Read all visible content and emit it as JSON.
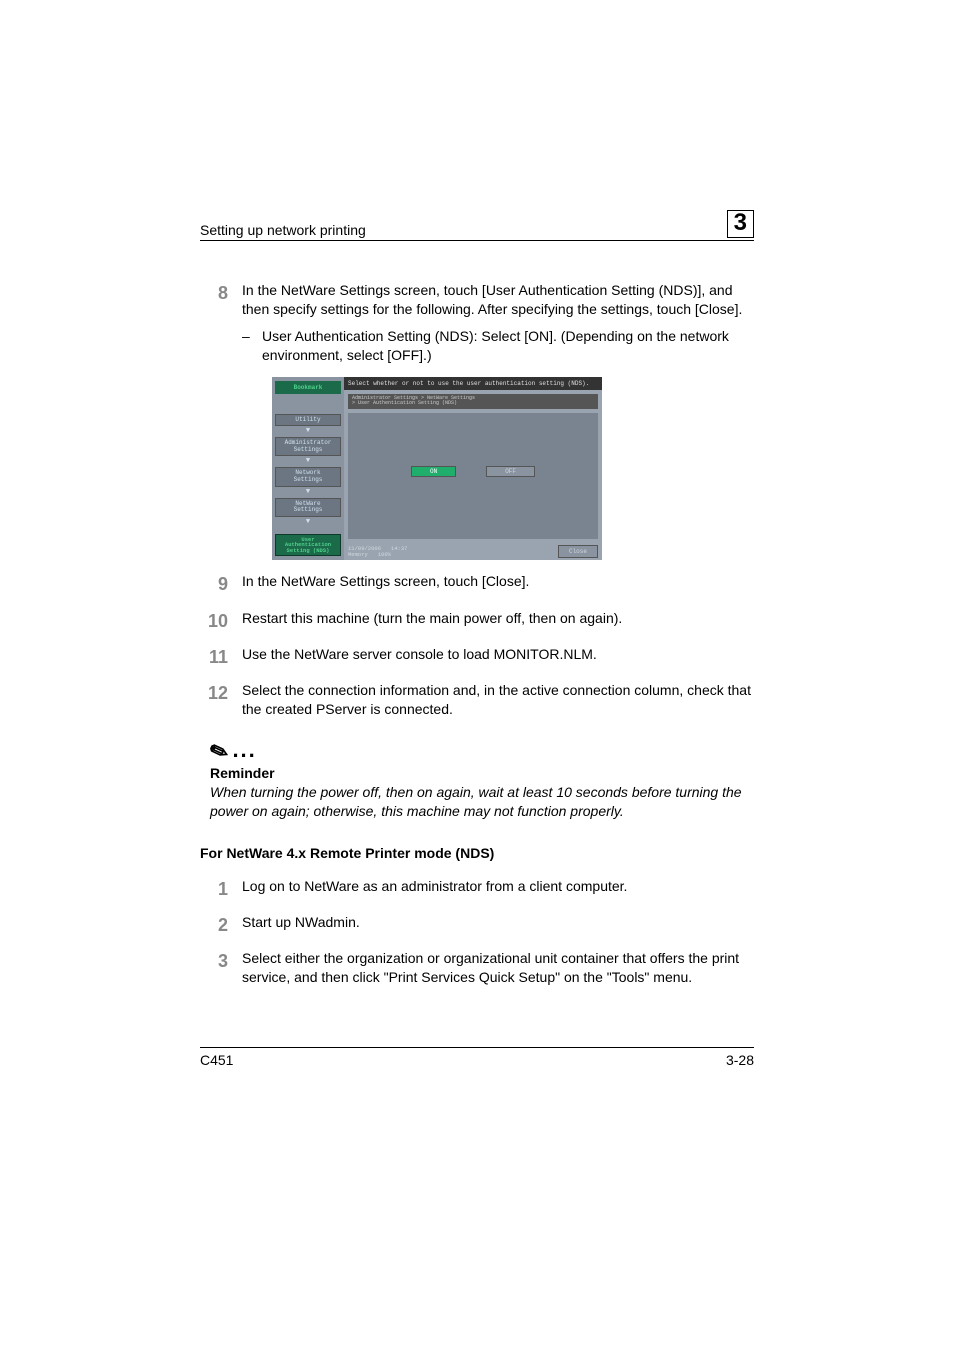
{
  "header": {
    "title": "Setting up network printing",
    "chapter": "3"
  },
  "steps_a": [
    {
      "num": "8",
      "text": "In the NetWare Settings screen, touch [User Authentication Setting (NDS)], and then specify settings for the following. After specifying the settings, touch [Close]."
    },
    {
      "num": "9",
      "text": "In the NetWare Settings screen, touch [Close]."
    },
    {
      "num": "10",
      "text": "Restart this machine (turn the main power off, then on again)."
    },
    {
      "num": "11",
      "text": "Use the NetWare server console to load MONITOR.NLM."
    },
    {
      "num": "12",
      "text": "Select the connection information and, in the active connection column, check that the created PServer is connected."
    }
  ],
  "sub8": "User Authentication Setting (NDS): Select [ON]. (Depending on the network environment, select [OFF].)",
  "dash": "–",
  "screen": {
    "bookmark": "Bookmark",
    "nav": {
      "utility": "Utility",
      "admin": "Administrator\nSettings",
      "network": "Network\nSettings",
      "netware": "NetWare\nSettings",
      "active": "User\nAuthentication\nSetting (NDS)"
    },
    "instruction": "Select whether or not to use the user authentication setting (NDS).",
    "breadcrumb": "Administrator Settings > NetWare Settings\n> User Authentication Setting (NDS)",
    "on": "ON",
    "off": "OFF",
    "date": "11/09/2006",
    "time": "14:37",
    "memory_label": "Memory",
    "memory_value": "100%",
    "close": "Close"
  },
  "note": {
    "label": "Reminder",
    "body": "When turning the power off, then on again, wait at least 10 seconds before turning the power on again; otherwise, this machine may not function properly."
  },
  "section2": "For NetWare 4.x Remote Printer mode (NDS)",
  "steps_b": [
    {
      "num": "1",
      "text": "Log on to NetWare as an administrator from a client computer."
    },
    {
      "num": "2",
      "text": "Start up NWadmin."
    },
    {
      "num": "3",
      "text": "Select either the organization or organizational unit container that offers the print service, and then click \"Print Services Quick Setup\" on the \"Tools\" menu."
    }
  ],
  "footer": {
    "left": "C451",
    "right": "3-28"
  }
}
